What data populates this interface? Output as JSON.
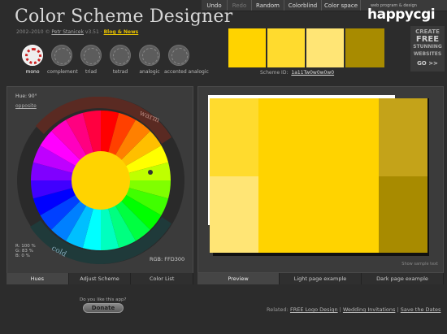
{
  "header": {
    "title": "Color Scheme Designer",
    "subline_prefix": "2002–2010 ©",
    "author_link": "Petr Stanicek",
    "version": "v3.51",
    "blog_link": "Blog & News"
  },
  "menu": {
    "items": [
      {
        "label": "Undo",
        "disabled": false
      },
      {
        "label": "Redo",
        "disabled": true
      },
      {
        "label": "Random",
        "disabled": false
      },
      {
        "label": "Colorblind",
        "disabled": false
      },
      {
        "label": "Color space",
        "disabled": false
      }
    ]
  },
  "brand": {
    "name": "happycgi",
    "sub": "web program & design"
  },
  "promo": {
    "line1": "CREATE",
    "line2": "FREE",
    "line3": "STUNNING",
    "line4": "WEBSITES",
    "go": "GO >>"
  },
  "scheme_types": [
    {
      "label": "mono",
      "selected": true
    },
    {
      "label": "complement",
      "selected": false
    },
    {
      "label": "triad",
      "selected": false
    },
    {
      "label": "tetrad",
      "selected": false
    },
    {
      "label": "analogic",
      "selected": false
    },
    {
      "label": "accented analogic",
      "selected": false
    }
  ],
  "palette": {
    "swatches": [
      "#FFD300",
      "#FFDB2E",
      "#FFE575",
      "#A88B00"
    ],
    "scheme_id_label": "Scheme ID:",
    "scheme_id": "1a11Tw0w0w0w0"
  },
  "wheel": {
    "hue_label": "Hue: 90°",
    "opposite_link": "opposite",
    "warm_label": "warm",
    "cold_label": "cold",
    "rgb_lines": [
      "R: 100 %",
      "G:  83 %",
      "B:   0 %"
    ],
    "rgb_hex": "RGB: FFD300",
    "center_color": "#FFD300"
  },
  "left_tabs": [
    {
      "label": "Hues",
      "active": true
    },
    {
      "label": "Adjust Scheme",
      "active": false
    },
    {
      "label": "Color List",
      "active": false
    }
  ],
  "preview": {
    "show_sample_text": "Show sample text",
    "colors": {
      "main": "#FFD300",
      "light": "#FFE575",
      "mid": "#FFDB2E",
      "dark": "#A88B00",
      "darkish": "#C4A319"
    }
  },
  "right_tabs": [
    {
      "label": "Preview",
      "active": true
    },
    {
      "label": "Light page example",
      "active": false
    },
    {
      "label": "Dark page example",
      "active": false
    }
  ],
  "footer": {
    "donate_question": "Do you like this app?",
    "donate_label": "Donate",
    "related_label": "Related:",
    "related_links": [
      "FREE Logo Design",
      "Wedding Invitations",
      "Save the Dates"
    ]
  }
}
